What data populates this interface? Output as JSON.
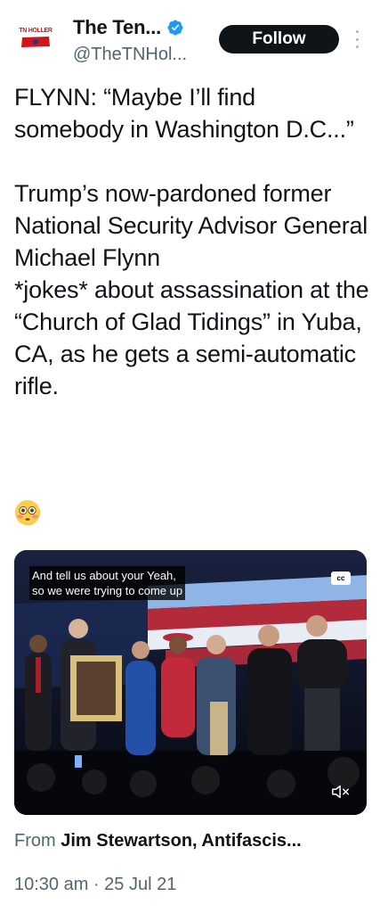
{
  "author": {
    "display_name": "The Ten...",
    "handle": "@TheTNHol...",
    "avatar_text": "TN HOLLER",
    "verified": true
  },
  "follow_button": {
    "label": "Follow"
  },
  "menu": {
    "icon": "more-vertical-icon"
  },
  "tweet": {
    "text": "FLYNN: “Maybe I’ll find somebody in Washington D.C...”\n\nTrump’s now-pardoned former National Security Advisor General Michael Flynn\n*jokes* about assassination at the “Church of Glad Tidings” in Yuba, CA, as he gets a semi-automatic rifle.",
    "emoji": "flushed-face"
  },
  "video": {
    "caption": "And tell us about your Yeah,\nso we were trying to come up",
    "cc_label": "cc",
    "mute_icon": "volume-muted-icon"
  },
  "attribution": {
    "prefix": "From",
    "source": "Jim Stewartson, Antifascis..."
  },
  "meta": {
    "timestamp": "10:30 am · 25 Jul 21"
  },
  "colors": {
    "text_primary": "#0f1419",
    "text_secondary": "#536471",
    "verified_blue": "#1d9bf0",
    "button_dark": "#0f1419"
  }
}
